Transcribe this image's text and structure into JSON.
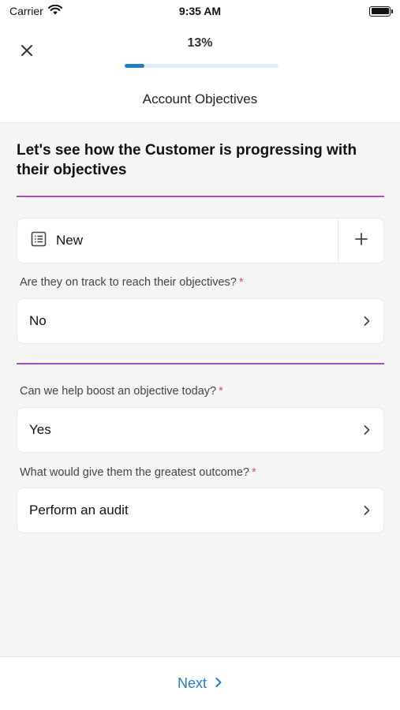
{
  "status_bar": {
    "carrier": "Carrier",
    "time": "9:35 AM"
  },
  "header": {
    "progress_text": "13%",
    "progress_value": 0.13,
    "title": "Account Objectives"
  },
  "question": {
    "heading": "Let's see how the Customer is progressing with their objectives"
  },
  "new_record": {
    "label": "New"
  },
  "fields": [
    {
      "label": "Are they on track to reach their objectives?",
      "required_mark": "*",
      "value": "No"
    },
    {
      "label": "Can we help boost an objective today?",
      "required_mark": "*",
      "value": "Yes"
    },
    {
      "label": "What would give them the greatest outcome?",
      "required_mark": "*",
      "value": "Perform an audit"
    }
  ],
  "footer": {
    "next_label": "Next"
  },
  "colors": {
    "accent": "#1e7fc4",
    "divider": "#a94fc2",
    "required": "#d9534f"
  }
}
